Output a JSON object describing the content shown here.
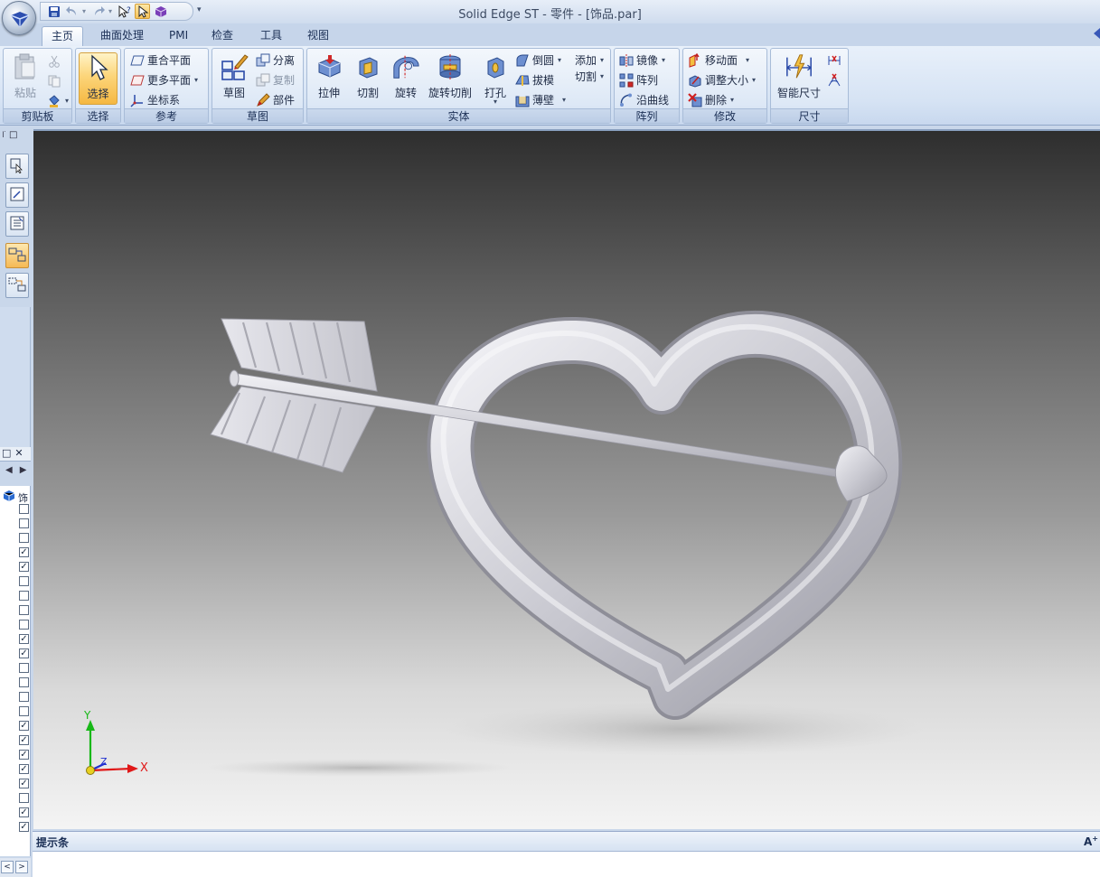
{
  "window": {
    "title": "Solid Edge ST - 零件 - [饰品.par]"
  },
  "tabs": [
    "主页",
    "曲面处理",
    "PMI",
    "检查",
    "工具",
    "视图"
  ],
  "ribbon": {
    "clipboard": {
      "label": "剪贴板",
      "paste": "粘贴"
    },
    "select": {
      "label": "选择",
      "select_btn": "选择"
    },
    "reference": {
      "label": "参考",
      "coincident_plane": "重合平面",
      "more_planes": "更多平面",
      "coord_system": "坐标系"
    },
    "sketch": {
      "label": "草图",
      "sketch_btn": "草图",
      "detach": "分离",
      "copy": "复制",
      "part": "部件"
    },
    "solid": {
      "label": "实体",
      "extrude": "拉伸",
      "cut": "切割",
      "revolve": "旋转",
      "revolve_cut": "旋转切削",
      "hole": "打孔",
      "round": "倒圆",
      "add": "添加",
      "draft": "拔模",
      "cut2": "切割",
      "thin_wall": "薄壁"
    },
    "pattern": {
      "label": "阵列",
      "mirror": "镜像",
      "pattern": "阵列",
      "along_curve": "沿曲线"
    },
    "modify": {
      "label": "修改",
      "move_face": "移动面",
      "resize": "调整大小",
      "delete": "删除"
    },
    "dimension": {
      "label": "尺寸",
      "smart_dimension": "智能尺寸"
    }
  },
  "tree": {
    "checkboxes": [
      false,
      false,
      false,
      true,
      true,
      false,
      false,
      false,
      false,
      true,
      true,
      false,
      false,
      false,
      false,
      true,
      true,
      true,
      true,
      true,
      false,
      true,
      true
    ]
  },
  "triad": {
    "x": "X",
    "y": "Y",
    "z": "Z"
  },
  "prompt_bar": {
    "title": "提示条"
  },
  "colors": {
    "accent_selected": "#f5b842",
    "ribbon_bg": "#d6e3f4",
    "axis_x": "#e01818",
    "axis_y": "#18b818",
    "axis_z": "#2030d0"
  }
}
